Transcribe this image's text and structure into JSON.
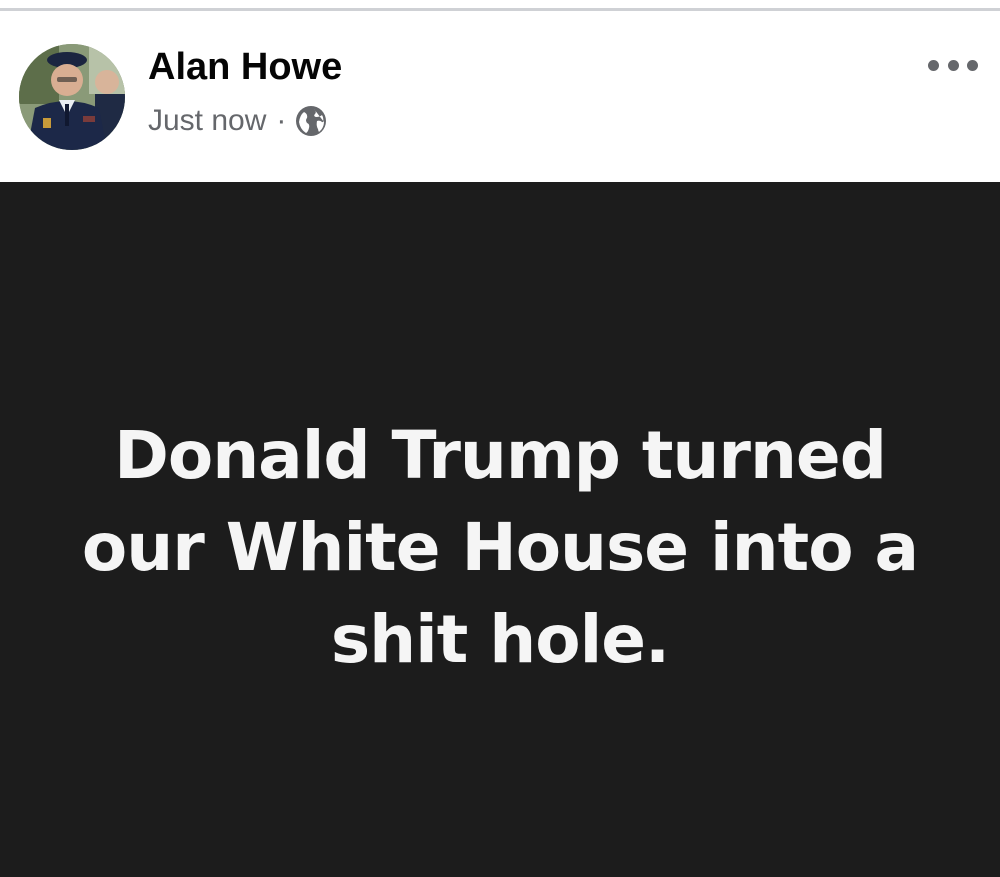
{
  "post": {
    "author": {
      "name": "Alan Howe",
      "avatar_icon": "profile-photo"
    },
    "timestamp": "Just now",
    "separator": "·",
    "audience_icon": "globe-icon",
    "more_icon": "more-options-icon",
    "body_text": "Donald Trump turned our White House into a shit hole.",
    "colors": {
      "background": "#1c1c1c",
      "text": "#f5f5f5",
      "secondary_text": "#65676b"
    }
  }
}
